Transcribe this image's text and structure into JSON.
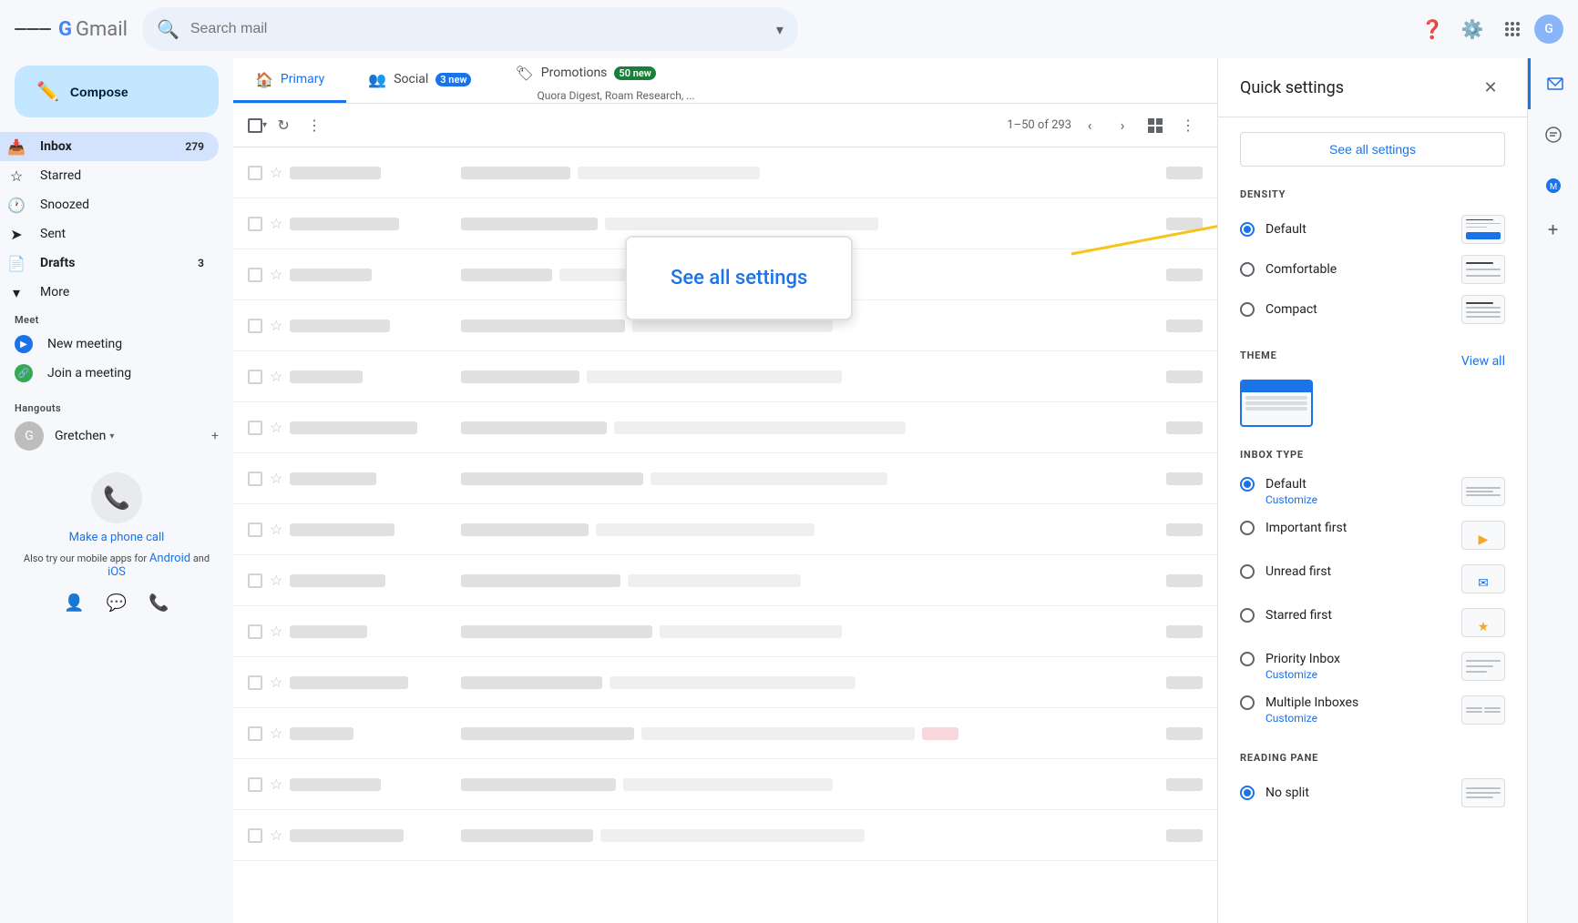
{
  "app": {
    "title": "Gmail",
    "logo_initial": "G"
  },
  "topbar": {
    "search_placeholder": "Search mail",
    "help_icon": "?",
    "settings_icon": "⚙",
    "apps_icon": "⋮⋮⋮"
  },
  "sidebar": {
    "compose_label": "Compose",
    "nav_items": [
      {
        "id": "inbox",
        "label": "Inbox",
        "icon": "📥",
        "badge": "279",
        "active": true
      },
      {
        "id": "starred",
        "label": "Starred",
        "icon": "☆",
        "badge": ""
      },
      {
        "id": "snoozed",
        "label": "Snoozed",
        "icon": "🕐",
        "badge": ""
      },
      {
        "id": "sent",
        "label": "Sent",
        "icon": "📤",
        "badge": ""
      },
      {
        "id": "drafts",
        "label": "Drafts",
        "icon": "📝",
        "badge": "3"
      },
      {
        "id": "more",
        "label": "More",
        "icon": "▾",
        "badge": ""
      }
    ],
    "meet_section": {
      "title": "Meet",
      "new_meeting": "New meeting",
      "join_meeting": "Join a meeting"
    },
    "hangouts_section": {
      "title": "Hangouts",
      "user": "Gretchen",
      "add_icon": "+"
    },
    "phone_section": {
      "call_link": "Make a phone call",
      "sub_text": "Also try our mobile apps for",
      "android_link": "Android",
      "and_text": "and",
      "ios_link": "iOS"
    }
  },
  "tabs": [
    {
      "id": "primary",
      "label": "Primary",
      "icon": "🏠",
      "active": true,
      "badge": ""
    },
    {
      "id": "social",
      "label": "Social",
      "icon": "👥",
      "active": false,
      "badge": "3 new"
    },
    {
      "id": "promotions",
      "label": "Promotions",
      "icon": "🏷",
      "active": false,
      "badge": "50 new",
      "sub": "Quora Digest, Roam Research, ..."
    }
  ],
  "toolbar": {
    "pagination": "1–50 of 293",
    "more_label": "⋮"
  },
  "email_rows": [
    {
      "sender": "",
      "subject": "",
      "snippet": "",
      "time": ""
    },
    {
      "sender": "",
      "subject": "",
      "snippet": "",
      "time": ""
    },
    {
      "sender": "",
      "subject": "",
      "snippet": "",
      "time": ""
    },
    {
      "sender": "",
      "subject": "",
      "snippet": "",
      "time": ""
    },
    {
      "sender": "",
      "subject": "",
      "snippet": "",
      "time": ""
    },
    {
      "sender": "",
      "subject": "",
      "snippet": "",
      "time": ""
    },
    {
      "sender": "",
      "subject": "",
      "snippet": "",
      "time": ""
    },
    {
      "sender": "",
      "subject": "",
      "snippet": "",
      "time": ""
    },
    {
      "sender": "",
      "subject": "",
      "snippet": "",
      "time": ""
    },
    {
      "sender": "",
      "subject": "",
      "snippet": "",
      "time": ""
    },
    {
      "sender": "",
      "subject": "",
      "snippet": "",
      "time": ""
    },
    {
      "sender": "",
      "subject": "",
      "snippet": "",
      "time": ""
    },
    {
      "sender": "",
      "subject": "",
      "snippet": "",
      "time": ""
    },
    {
      "sender": "",
      "subject": "",
      "snippet": "",
      "time": ""
    }
  ],
  "quick_settings": {
    "title": "Quick settings",
    "see_all_label": "See all settings",
    "density_label": "DENSITY",
    "density_options": [
      {
        "id": "default",
        "label": "Default",
        "selected": true
      },
      {
        "id": "comfortable",
        "label": "Comfortable",
        "selected": false
      },
      {
        "id": "compact",
        "label": "Compact",
        "selected": false
      }
    ],
    "theme_label": "THEME",
    "view_all_label": "View all",
    "inbox_type_label": "INBOX TYPE",
    "inbox_options": [
      {
        "id": "default",
        "label": "Default",
        "sub": "Customize",
        "selected": true
      },
      {
        "id": "important",
        "label": "Important first",
        "sub": "",
        "selected": false
      },
      {
        "id": "unread",
        "label": "Unread first",
        "sub": "",
        "selected": false
      },
      {
        "id": "starred",
        "label": "Starred first",
        "sub": "",
        "selected": false
      },
      {
        "id": "priority",
        "label": "Priority Inbox",
        "sub": "Customize",
        "selected": false
      },
      {
        "id": "multiple",
        "label": "Multiple Inboxes",
        "sub": "Customize",
        "selected": false
      }
    ],
    "reading_pane_label": "READING PANE",
    "reading_options": [
      {
        "id": "no_split",
        "label": "No split",
        "selected": true
      }
    ]
  },
  "callout": {
    "label": "See all settings"
  }
}
